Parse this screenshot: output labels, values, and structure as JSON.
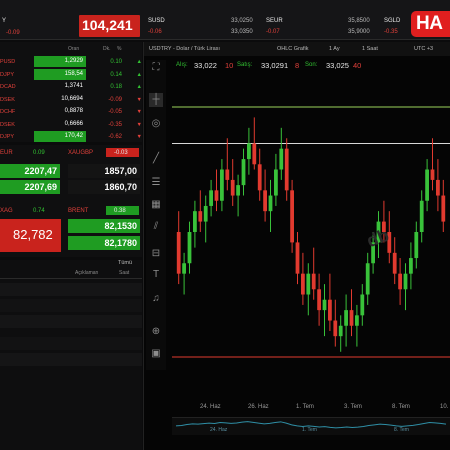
{
  "topbar": {
    "left_label": "Y",
    "left_change": "-0.09",
    "main_price": "104,241",
    "tickers": [
      {
        "symbol": "SUSD",
        "change": "-0.06",
        "bid": "33,0250",
        "ask": "33,0350"
      },
      {
        "symbol": "SEUR",
        "change": "-0.07",
        "bid": "35,8500",
        "ask": "35,9000"
      },
      {
        "symbol": "SGLD",
        "change": "-0.35"
      }
    ],
    "logo": "HA"
  },
  "watchlist": {
    "headers": {
      "price": "Oran",
      "change": "Dk.",
      "pct": "%"
    },
    "rows": [
      {
        "symbol": "PUSD",
        "price": "1,2929",
        "change": "0.10",
        "pct": "▲",
        "price_bg": "green",
        "dir": "up"
      },
      {
        "symbol": "DJPY",
        "price": "158,54",
        "change": "0.14",
        "pct": "▲",
        "price_bg": "green",
        "dir": "up"
      },
      {
        "symbol": "DCAD",
        "price": "1,3741",
        "change": "0.18",
        "pct": "▲",
        "price_bg": "none",
        "dir": "up"
      },
      {
        "symbol": "DSEK",
        "price": "10,6694",
        "change": "-0.09",
        "pct": "▼",
        "price_bg": "none",
        "dir": "down"
      },
      {
        "symbol": "DCHF",
        "price": "0,8878",
        "change": "-0.05",
        "pct": "▼",
        "price_bg": "none",
        "dir": "down"
      },
      {
        "symbol": "DSEK",
        "price": "0,6666",
        "change": "-0.35",
        "pct": "▼",
        "price_bg": "none",
        "dir": "down"
      },
      {
        "symbol": "DJPY",
        "price": "170,42",
        "change": "-0.62",
        "pct": "▼",
        "price_bg": "green",
        "dir": "down"
      }
    ]
  },
  "pairs": {
    "eur": {
      "label": "EUR",
      "change": "0.09",
      "bid": "2207,47",
      "ask": "2207,69"
    },
    "xaugbp": {
      "label": "XAUGBP",
      "change": "-0.03",
      "bid": "1857,00",
      "ask": "1860,70"
    },
    "xag": {
      "label": "XAG",
      "change": "0.74",
      "price": "82,782"
    },
    "brent": {
      "label": "BRENT",
      "change": "0.38",
      "bid": "82,1530",
      "ask": "82,1780"
    }
  },
  "news": {
    "all_label": "Tümü",
    "col_desc": "Açıklaman",
    "col_time": "Saat"
  },
  "chart_header": {
    "symbol": "USDTRY - Dolar / Türk Lirası",
    "chart_type": "OHLC Grafik",
    "period": "1 Ay",
    "interval": "1 Saat",
    "tz": "UTC +3",
    "buy_label": "Alış:",
    "buy_value": "33,022",
    "buy_suffix": "10",
    "sell_label": "Satış:",
    "sell_value": "33,0291",
    "sell_suffix": "8",
    "last_label": "Son:",
    "last_value": "33,025",
    "last_suffix": "40"
  },
  "chart_data": {
    "type": "candlestick",
    "x_labels": [
      "24. Haz",
      "26. Haz",
      "1. Tem",
      "3. Tem",
      "8. Tem",
      "10. Tem"
    ],
    "navigator_labels": [
      "24. Haz",
      "1. Tem",
      "8. Tem"
    ],
    "watermark": "db",
    "colors": {
      "up": "#39c23a",
      "down": "#e13a2f",
      "hline_green": "#9bd35a",
      "hline_white": "#d8d8d8",
      "hline_red": "#e13a2f"
    },
    "series": [
      {
        "open": 33.08,
        "high": 33.12,
        "low": 32.98,
        "close": 33.0
      },
      {
        "open": 33.0,
        "high": 33.04,
        "low": 32.96,
        "close": 33.02
      },
      {
        "open": 33.02,
        "high": 33.1,
        "low": 33.0,
        "close": 33.08
      },
      {
        "open": 33.08,
        "high": 33.14,
        "low": 33.05,
        "close": 33.12
      },
      {
        "open": 33.12,
        "high": 33.16,
        "low": 33.08,
        "close": 33.1
      },
      {
        "open": 33.1,
        "high": 33.15,
        "low": 33.06,
        "close": 33.13
      },
      {
        "open": 33.13,
        "high": 33.18,
        "low": 33.11,
        "close": 33.16
      },
      {
        "open": 33.16,
        "high": 33.2,
        "low": 33.12,
        "close": 33.14
      },
      {
        "open": 33.14,
        "high": 33.22,
        "low": 33.12,
        "close": 33.2
      },
      {
        "open": 33.2,
        "high": 33.26,
        "low": 33.16,
        "close": 33.18
      },
      {
        "open": 33.18,
        "high": 33.22,
        "low": 33.13,
        "close": 33.15
      },
      {
        "open": 33.15,
        "high": 33.19,
        "low": 33.11,
        "close": 33.17
      },
      {
        "open": 33.17,
        "high": 33.24,
        "low": 33.15,
        "close": 33.22
      },
      {
        "open": 33.22,
        "high": 33.28,
        "low": 33.19,
        "close": 33.25
      },
      {
        "open": 33.25,
        "high": 33.3,
        "low": 33.2,
        "close": 33.21
      },
      {
        "open": 33.21,
        "high": 33.24,
        "low": 33.14,
        "close": 33.16
      },
      {
        "open": 33.16,
        "high": 33.2,
        "low": 33.1,
        "close": 33.12
      },
      {
        "open": 33.12,
        "high": 33.18,
        "low": 33.08,
        "close": 33.15
      },
      {
        "open": 33.15,
        "high": 33.23,
        "low": 33.13,
        "close": 33.2
      },
      {
        "open": 33.2,
        "high": 33.28,
        "low": 33.18,
        "close": 33.24
      },
      {
        "open": 33.24,
        "high": 33.26,
        "low": 33.14,
        "close": 33.16
      },
      {
        "open": 33.16,
        "high": 33.18,
        "low": 33.04,
        "close": 33.06
      },
      {
        "open": 33.06,
        "high": 33.08,
        "low": 32.98,
        "close": 33.0
      },
      {
        "open": 33.0,
        "high": 33.04,
        "low": 32.94,
        "close": 32.96
      },
      {
        "open": 32.96,
        "high": 33.02,
        "low": 32.92,
        "close": 33.0
      },
      {
        "open": 33.0,
        "high": 33.05,
        "low": 32.95,
        "close": 32.97
      },
      {
        "open": 32.97,
        "high": 33.0,
        "low": 32.9,
        "close": 32.93
      },
      {
        "open": 32.93,
        "high": 32.98,
        "low": 32.88,
        "close": 32.95
      },
      {
        "open": 32.95,
        "high": 33.0,
        "low": 32.89,
        "close": 32.91
      },
      {
        "open": 32.91,
        "high": 32.95,
        "low": 32.86,
        "close": 32.88
      },
      {
        "open": 32.88,
        "high": 32.92,
        "low": 32.85,
        "close": 32.9
      },
      {
        "open": 32.9,
        "high": 32.96,
        "low": 32.86,
        "close": 32.93
      },
      {
        "open": 32.93,
        "high": 32.97,
        "low": 32.88,
        "close": 32.9
      },
      {
        "open": 32.9,
        "high": 32.94,
        "low": 32.86,
        "close": 32.92
      },
      {
        "open": 32.92,
        "high": 32.98,
        "low": 32.9,
        "close": 32.96
      },
      {
        "open": 32.96,
        "high": 33.04,
        "low": 32.94,
        "close": 33.02
      },
      {
        "open": 33.02,
        "high": 33.08,
        "low": 33.0,
        "close": 33.06
      },
      {
        "open": 33.06,
        "high": 33.12,
        "low": 33.03,
        "close": 33.1
      },
      {
        "open": 33.1,
        "high": 33.14,
        "low": 33.06,
        "close": 33.08
      },
      {
        "open": 33.08,
        "high": 33.12,
        "low": 33.02,
        "close": 33.04
      },
      {
        "open": 33.04,
        "high": 33.07,
        "low": 32.98,
        "close": 33.0
      },
      {
        "open": 33.0,
        "high": 33.03,
        "low": 32.94,
        "close": 32.97
      },
      {
        "open": 32.97,
        "high": 33.02,
        "low": 32.93,
        "close": 33.0
      },
      {
        "open": 33.0,
        "high": 33.06,
        "low": 32.97,
        "close": 33.03
      },
      {
        "open": 33.03,
        "high": 33.1,
        "low": 33.01,
        "close": 33.08
      },
      {
        "open": 33.08,
        "high": 33.16,
        "low": 33.06,
        "close": 33.14
      },
      {
        "open": 33.14,
        "high": 33.22,
        "low": 33.12,
        "close": 33.2
      },
      {
        "open": 33.2,
        "high": 33.26,
        "low": 33.16,
        "close": 33.18
      },
      {
        "open": 33.18,
        "high": 33.22,
        "low": 33.12,
        "close": 33.15
      },
      {
        "open": 33.15,
        "high": 33.18,
        "low": 33.08,
        "close": 33.1
      }
    ],
    "hlines": [
      {
        "value": 33.32,
        "color": "green"
      },
      {
        "value": 33.25,
        "color": "white"
      },
      {
        "value": 32.84,
        "color": "red"
      }
    ]
  }
}
